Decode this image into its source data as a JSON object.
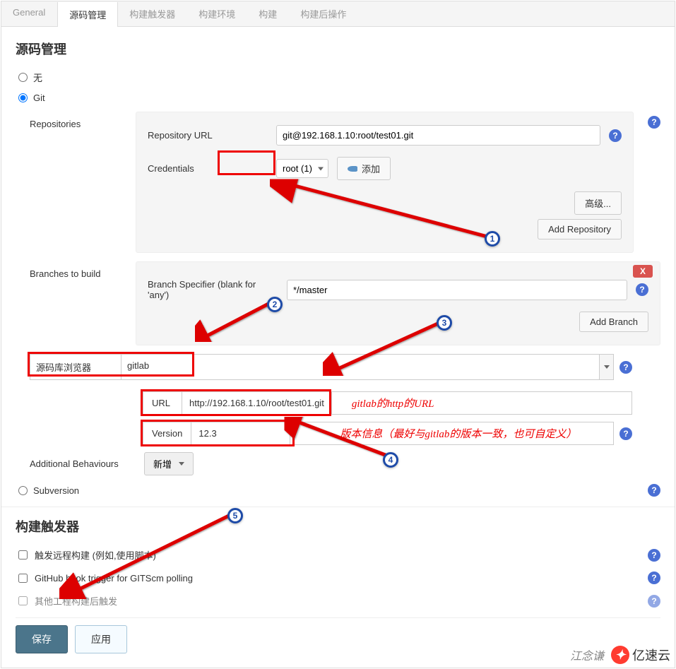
{
  "tabs": {
    "general": "General",
    "scm": "源码管理",
    "triggers": "构建触发器",
    "env": "构建环境",
    "build": "构建",
    "post": "构建后操作"
  },
  "section_scm": "源码管理",
  "radio_none": "无",
  "radio_git": "Git",
  "radio_svn": "Subversion",
  "repositories": {
    "label": "Repositories",
    "url_label": "Repository URL",
    "url_value": "git@192.168.1.10:root/test01.git",
    "creds_label": "Credentials",
    "creds_selected": "root (1)",
    "add_btn": "添加",
    "advanced_btn": "高级...",
    "add_repo_btn": "Add Repository"
  },
  "branches": {
    "label": "Branches to build",
    "specifier_label": "Branch Specifier (blank for 'any')",
    "specifier_value": "*/master",
    "add_branch_btn": "Add Branch",
    "delete_x": "X"
  },
  "browser": {
    "label": "源码库浏览器",
    "selected": "gitlab",
    "url_label": "URL",
    "url_value": "http://192.168.1.10/root/test01.git",
    "url_hint": "gitlab的http的URL",
    "version_label": "Version",
    "version_value": "12.3",
    "version_hint": "版本信息（最好与gitlab的版本一致，也可自定义）"
  },
  "additional": {
    "label": "Additional Behaviours",
    "btn": "新增"
  },
  "section_triggers": "构建触发器",
  "trigger_opts": {
    "remote": "触发远程构建 (例如,使用脚本)",
    "github": "GitHub hook trigger for GITScm polling",
    "other": "其他工程构建后触发"
  },
  "save_btn": "保存",
  "apply_btn": "应用",
  "badges": {
    "b1": "1",
    "b2": "2",
    "b3": "3",
    "b4": "4",
    "b5": "5"
  },
  "watermark_author": "江念谦",
  "watermark_brand": "亿速云",
  "help_glyph": "?"
}
